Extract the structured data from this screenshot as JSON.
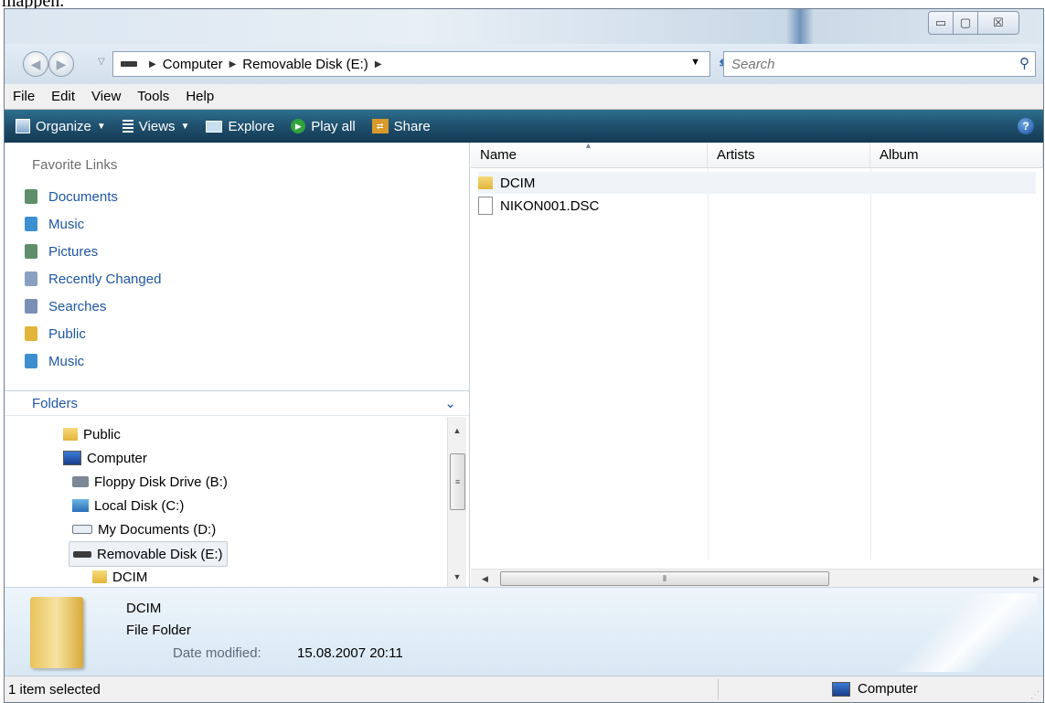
{
  "doc_fragment": "mappen.",
  "window_controls": {
    "minimize": "▭",
    "maximize": "▢",
    "close": "☒"
  },
  "address": {
    "crumbs": [
      "Computer",
      "Removable Disk (E:)"
    ],
    "search_placeholder": "Search"
  },
  "menu": [
    "File",
    "Edit",
    "View",
    "Tools",
    "Help"
  ],
  "toolbar": {
    "organize": "Organize",
    "views": "Views",
    "explore": "Explore",
    "play_all": "Play all",
    "share": "Share",
    "help": "?"
  },
  "favorites": {
    "header": "Favorite Links",
    "items": [
      {
        "label": "Documents",
        "icon": "documents-icon",
        "color": "#5f8f6a"
      },
      {
        "label": "Music",
        "icon": "music-icon",
        "color": "#3e8fd0"
      },
      {
        "label": "Pictures",
        "icon": "pictures-icon",
        "color": "#5f8f6a"
      },
      {
        "label": "Recently Changed",
        "icon": "recent-icon",
        "color": "#8aa0c0"
      },
      {
        "label": "Searches",
        "icon": "searches-icon",
        "color": "#7a8fb5"
      },
      {
        "label": "Public",
        "icon": "folder-icon",
        "color": "#e2b53b"
      },
      {
        "label": "Music",
        "icon": "music-icon",
        "color": "#3e8fd0"
      }
    ]
  },
  "folders": {
    "header": "Folders",
    "tree": [
      {
        "label": "Public",
        "icon": "folder-icon",
        "indent": 1
      },
      {
        "label": "Computer",
        "icon": "computer-icon",
        "indent": 1
      },
      {
        "label": "Floppy Disk Drive (B:)",
        "icon": "floppy-icon",
        "indent": 2
      },
      {
        "label": "Local Disk (C:)",
        "icon": "local-disk-icon",
        "indent": 2
      },
      {
        "label": "My Documents (D:)",
        "icon": "drive-icon",
        "indent": 2
      },
      {
        "label": "Removable Disk (E:)",
        "icon": "removable-disk-icon",
        "indent": 2,
        "selected": true
      },
      {
        "label": "DCIM",
        "icon": "folder-icon",
        "indent": 3
      }
    ]
  },
  "file_list": {
    "columns": [
      "Name",
      "Artists",
      "Album"
    ],
    "rows": [
      {
        "name": "DCIM",
        "icon": "folder-icon"
      },
      {
        "name": "NIKON001.DSC",
        "icon": "file-icon"
      }
    ]
  },
  "details": {
    "name": "DCIM",
    "type": "File Folder",
    "date_label": "Date modified:",
    "date_value": "15.08.2007 20:11"
  },
  "status": {
    "text": "1 item selected",
    "location": "Computer"
  }
}
